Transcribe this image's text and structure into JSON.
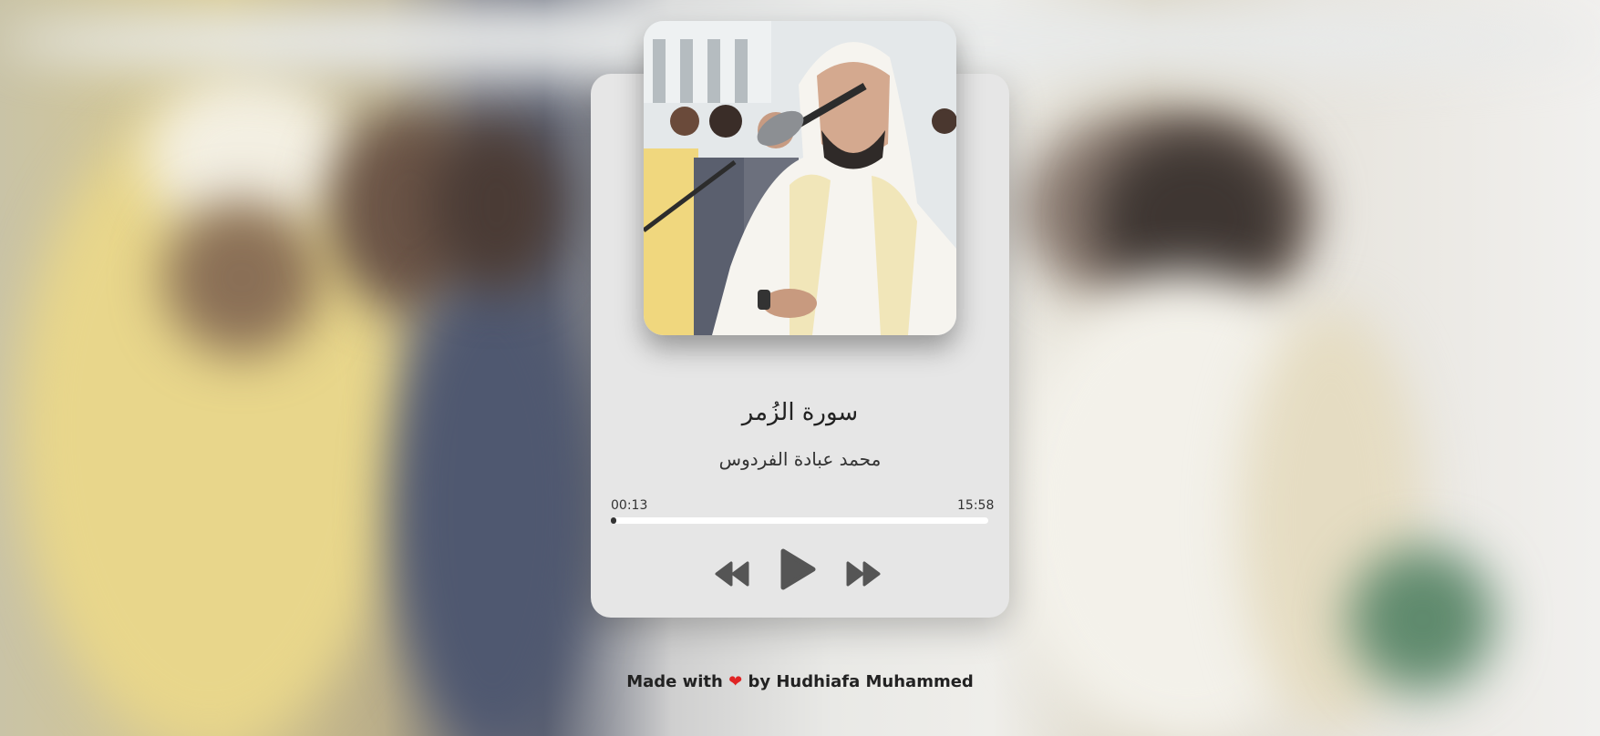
{
  "track": {
    "title": "سورة الزُمر",
    "artist": "محمد عبادة الفردوس",
    "current_time": "00:13",
    "total_time": "15:58",
    "progress": 0.0136
  },
  "controls": {
    "prev_icon": "rewind-icon",
    "play_icon": "play-icon",
    "next_icon": "fast-forward-icon"
  },
  "footer": {
    "prefix": "Made with",
    "heart": "❤",
    "suffix": "by Hudhiafa Muhammed"
  },
  "colors": {
    "card": "#e6e6e6",
    "control": "#555555",
    "heart": "#e02424"
  }
}
